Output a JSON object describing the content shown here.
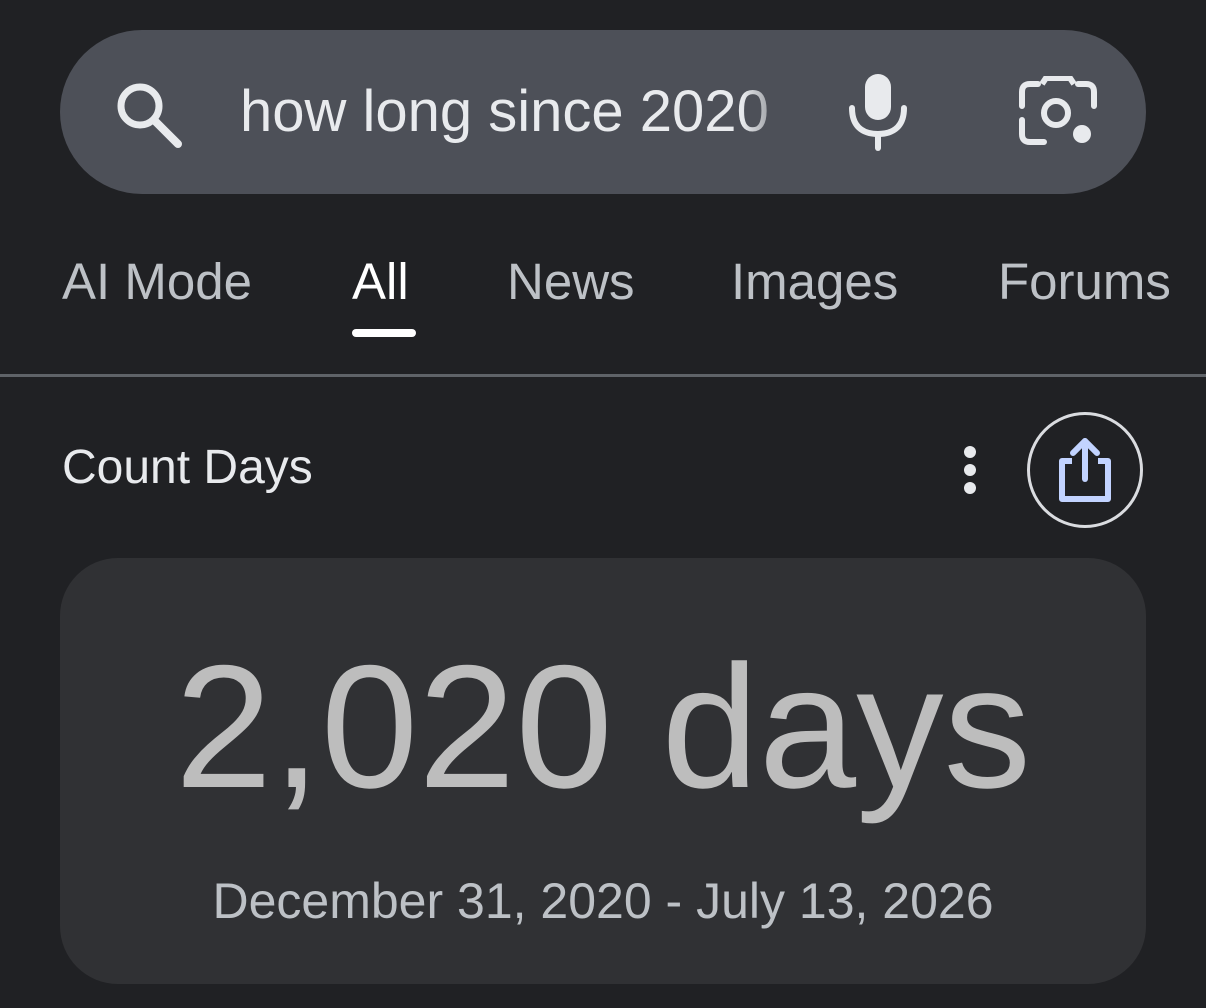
{
  "search": {
    "query": "how long since 2020",
    "icons": {
      "search": "search-icon",
      "voice": "mic-icon",
      "lens": "camera-lens-icon"
    }
  },
  "tabs": [
    {
      "label": "AI Mode",
      "active": false
    },
    {
      "label": "All",
      "active": true
    },
    {
      "label": "News",
      "active": false
    },
    {
      "label": "Images",
      "active": false
    },
    {
      "label": "Forums",
      "active": false
    }
  ],
  "result": {
    "title": "Count Days",
    "value": "2,020 days",
    "range": "December 31, 2020 - July 13, 2026",
    "icons": {
      "more": "more-vert-icon",
      "share": "share-icon"
    }
  },
  "colors": {
    "background": "#202124",
    "search_bar": "#4d5058",
    "card": "#303134",
    "active_tab": "#ffffff",
    "inactive_tab": "#bdc1c6",
    "result_value": "#bdbdbd"
  }
}
